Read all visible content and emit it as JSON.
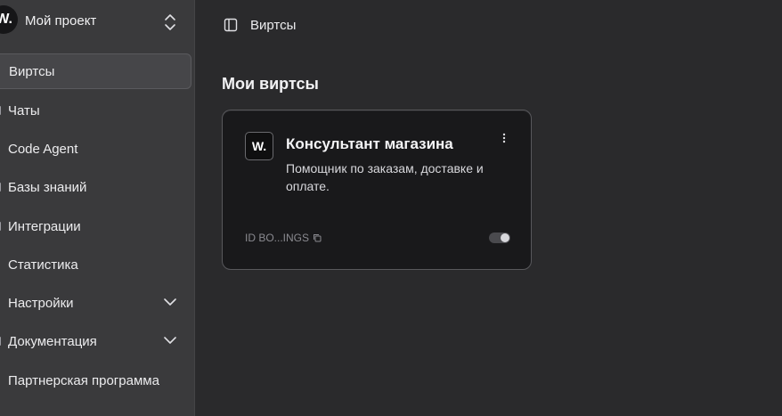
{
  "project": {
    "logo_text": "W.",
    "name": "Мой проект"
  },
  "sidebar": {
    "items": [
      {
        "label": "Виртсы",
        "active": true
      },
      {
        "label": "Чаты"
      },
      {
        "label": "Code Agent"
      },
      {
        "label": "Базы знаний"
      },
      {
        "label": "Интеграции"
      },
      {
        "label": "Статистика"
      },
      {
        "label": "Настройки",
        "expandable": true
      },
      {
        "label": "Документация",
        "expandable": true
      },
      {
        "label": "Партнерская программа"
      }
    ]
  },
  "header": {
    "breadcrumb": "Виртсы"
  },
  "main": {
    "title": "Мои виртсы",
    "cards": [
      {
        "logo_text": "W.",
        "title": "Консультант магазина",
        "description": "Помощник по заказам, доставке и оплате.",
        "id_label": "ID BO...INGS",
        "enabled": true
      }
    ]
  },
  "colors": {
    "sidebar_bg": "#3a3a3c",
    "main_bg": "#2a2a2c",
    "card_bg": "#19191b"
  },
  "icons": {
    "project_switch": "chevron-up-down-icon",
    "panel_toggle": "sidebar-panel-icon",
    "card_menu": "more-vertical-icon",
    "copy": "copy-icon",
    "expand": "chevron-down-icon"
  }
}
